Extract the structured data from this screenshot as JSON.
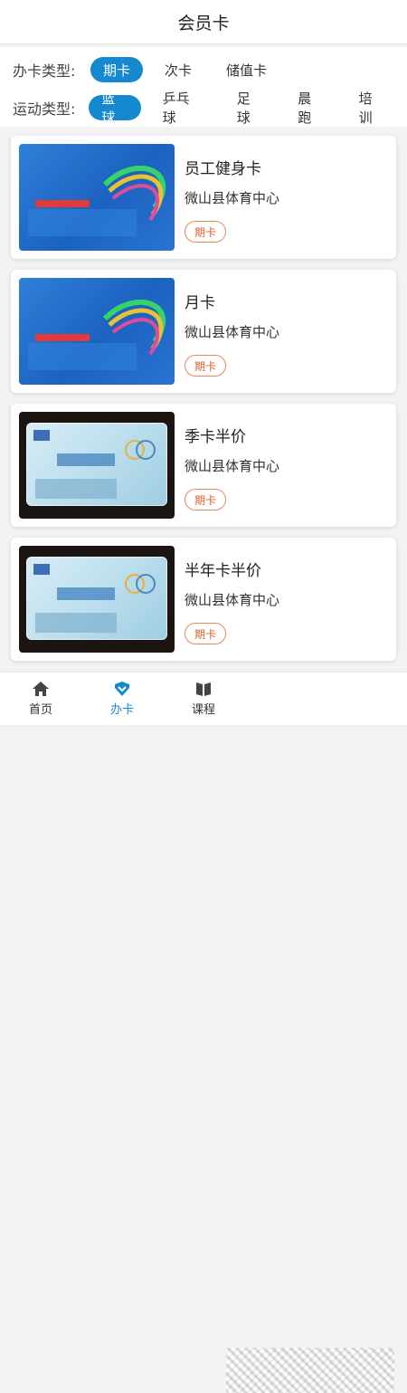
{
  "header": {
    "title": "会员卡"
  },
  "filters": {
    "card_type": {
      "label": "办卡类型:",
      "options": [
        "期卡",
        "次卡",
        "储值卡"
      ],
      "selected": "期卡"
    },
    "sport_type": {
      "label": "运动类型:",
      "options": [
        "篮球",
        "乒乓球",
        "足球",
        "晨跑",
        "培训"
      ],
      "selected": "篮球"
    }
  },
  "cards": [
    {
      "title": "员工健身卡",
      "venue": "微山县体育中心",
      "badge": "期卡",
      "image": "blue"
    },
    {
      "title": "月卡",
      "venue": "微山县体育中心",
      "badge": "期卡",
      "image": "blue"
    },
    {
      "title": "季卡半价",
      "venue": "微山县体育中心",
      "badge": "期卡",
      "image": "dark"
    },
    {
      "title": "半年卡半价",
      "venue": "微山县体育中心",
      "badge": "期卡",
      "image": "dark"
    }
  ],
  "tabs": [
    {
      "label": "首页",
      "icon": "home-icon"
    },
    {
      "label": "办卡",
      "icon": "card-icon",
      "active": true
    },
    {
      "label": "课程",
      "icon": "book-icon"
    }
  ],
  "colors": {
    "accent": "#1589cf",
    "badge": "#e0602b"
  }
}
